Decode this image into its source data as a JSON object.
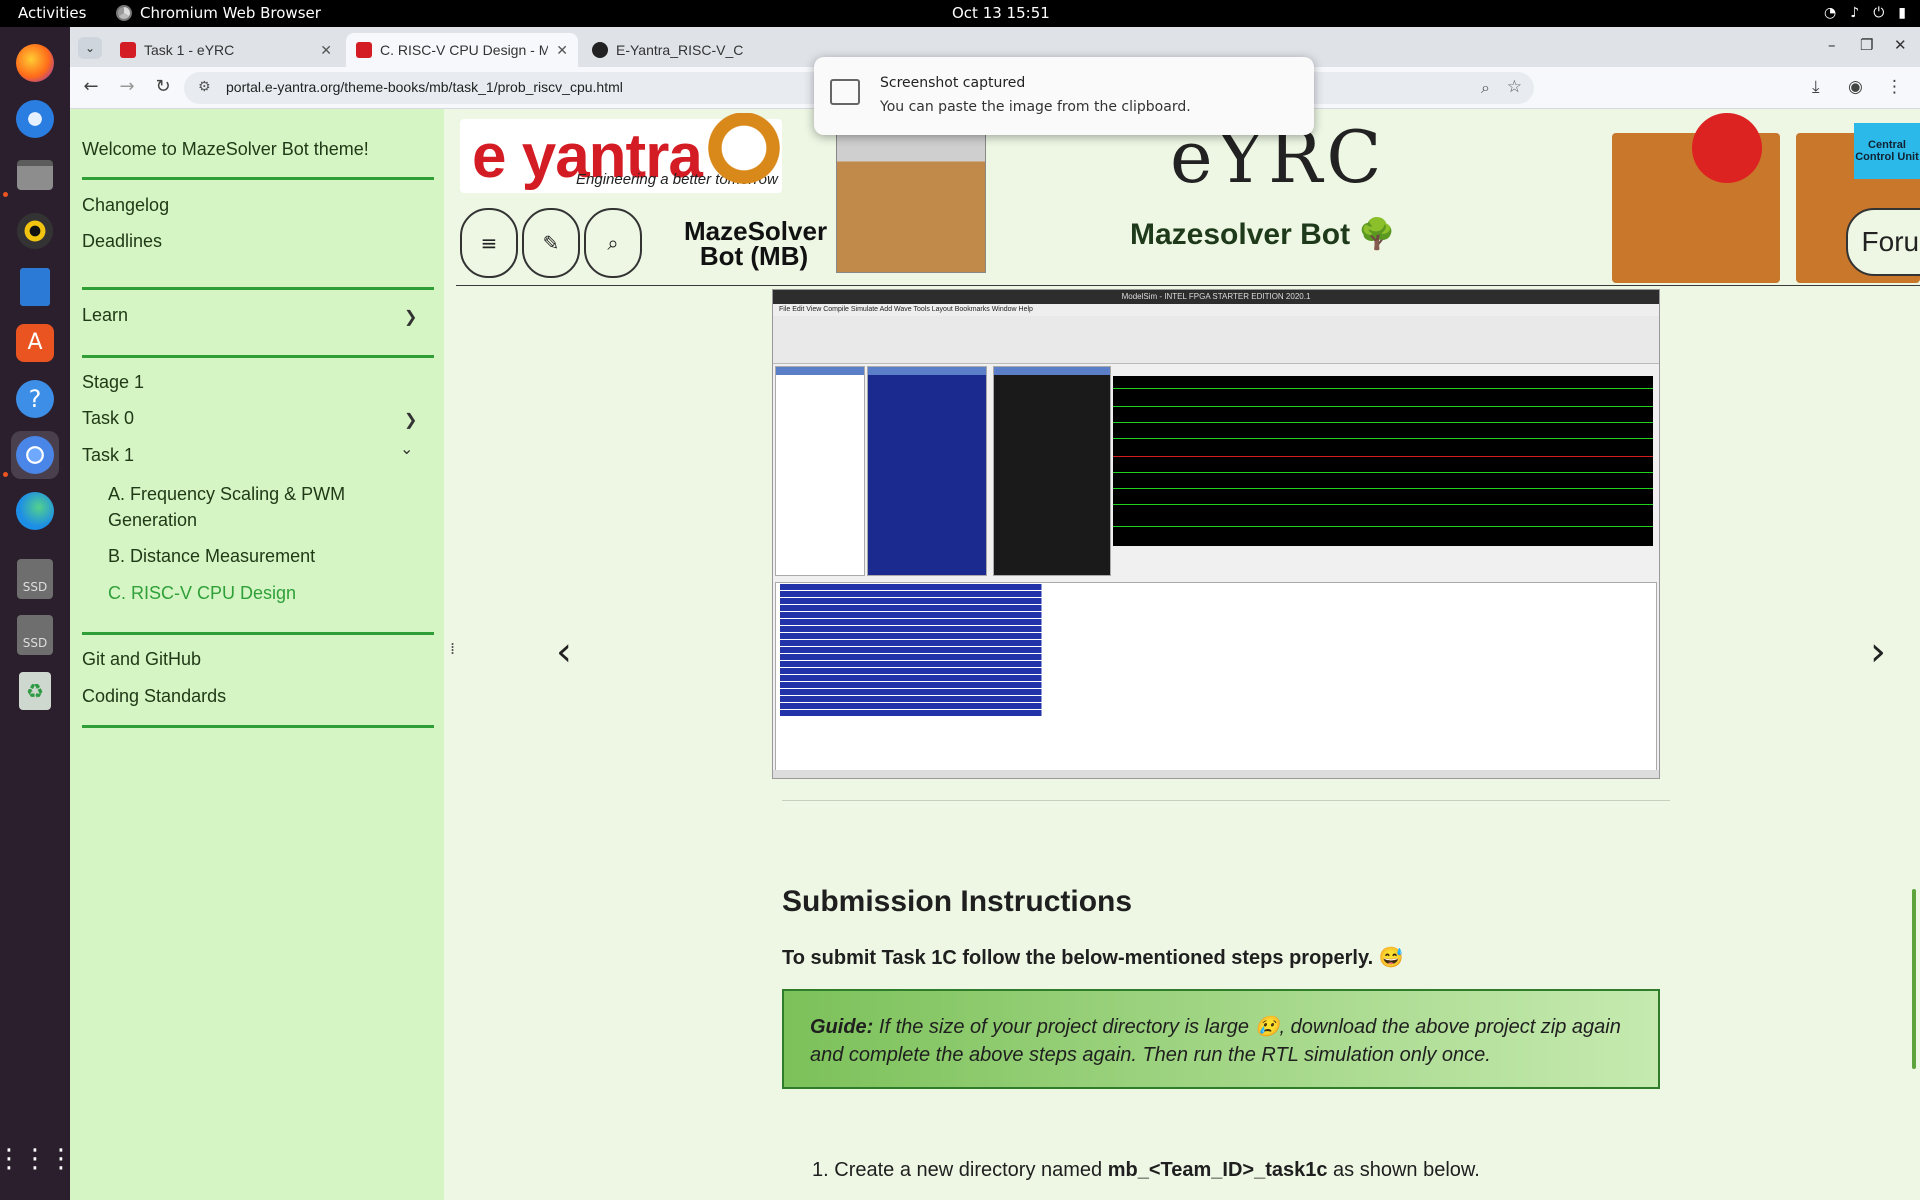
{
  "topbar": {
    "activities": "Activities",
    "app_name": "Chromium Web Browser",
    "clock": "Oct 13  15:51"
  },
  "dock": {
    "items": [
      "firefox-icon",
      "thunderbird-icon",
      "files-icon",
      "rhythmbox-icon",
      "writer-icon",
      "app-center-icon",
      "help-icon",
      "chromium-icon",
      "edge-icon",
      "ssd-icon",
      "ssd-icon",
      "trash-icon",
      "app-grid-icon"
    ],
    "ssd_label": "SSD"
  },
  "browser": {
    "tabs": [
      {
        "title": "Task 1 - eYRC"
      },
      {
        "title": "C. RISC-V CPU Design - M"
      },
      {
        "title": "E-Yantra_RISC-V_C"
      }
    ],
    "url": "portal.e-yantra.org/theme-books/mb/task_1/prob_riscv_cpu.html"
  },
  "notification": {
    "title": "Screenshot captured",
    "body": "You can paste the image from the clipboard."
  },
  "sidebar": {
    "welcome": "Welcome to MazeSolver Bot theme!",
    "changelog": "Changelog",
    "deadlines": "Deadlines",
    "learn": "Learn",
    "stage1": "Stage 1",
    "task0": "Task 0",
    "task1": "Task 1",
    "sub_a": "A. Frequency Scaling & PWM Generation",
    "sub_b": "B. Distance Measurement",
    "sub_c": "C. RISC-V CPU Design",
    "git": "Git and GitHub",
    "coding": "Coding Standards"
  },
  "header": {
    "logo_word": "e yantra",
    "logo_tagline": "Engineering a better tomorrow",
    "mb_caption": "MazeSolver Bot (MB)",
    "eyrc_logo": "eYRC",
    "site_title": "Mazesolver Bot 🌳",
    "ccu_label": "Central Control Unit",
    "forum": "Forum"
  },
  "simulator": {
    "window_title": "ModelSim - INTEL FPGA STARTER EDITION 2020.1",
    "menu": "File  Edit  View  Compile  Simulate  Add  Wave  Tools  Layout  Bookmarks  Window  Help"
  },
  "content": {
    "heading": "Submission Instructions",
    "lead": "To submit Task 1C follow the below-mentioned steps properly. 😅",
    "guide_label": "Guide:",
    "guide_text": " If the size of your project directory is large 😢, download the above project zip again and complete the above steps again. Then run the RTL simulation only once.",
    "step1_number": "1.",
    "step1_prefix": "Create a new directory named ",
    "step1_code": "mb_<Team_ID>_task1c",
    "step1_suffix": " as shown below."
  },
  "colors": {
    "sidebar_bg": "#d6f5c4",
    "page_bg": "#edf7e4",
    "accent_green": "#2f9e35",
    "active_link": "#2fa03a"
  }
}
